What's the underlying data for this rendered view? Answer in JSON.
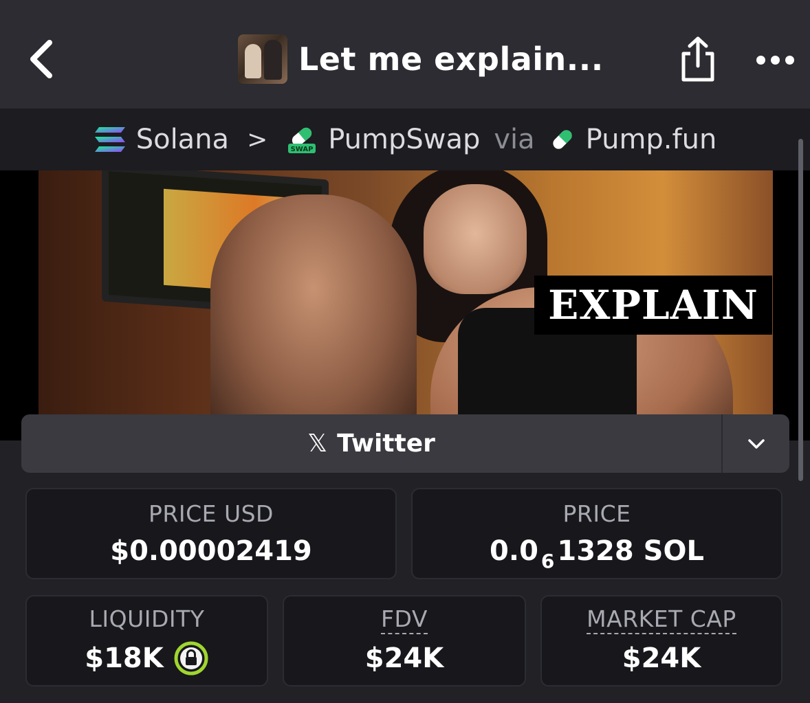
{
  "header": {
    "title": "Let me explain..."
  },
  "breadcrumb": {
    "chain": "Solana",
    "separator": ">",
    "dex": "PumpSwap",
    "dex_badge": "SWAP",
    "via_text": "via",
    "launchpad": "Pump.fun"
  },
  "banner": {
    "overlay_text": "EXPLAIN"
  },
  "links": {
    "twitter_label": "Twitter"
  },
  "stats": {
    "price_usd": {
      "label": "PRICE USD",
      "value": "$0.00002419"
    },
    "price": {
      "label": "PRICE",
      "value_prefix": "0.0",
      "value_subscript": "6",
      "value_suffix": "1328 SOL"
    },
    "liquidity": {
      "label": "LIQUIDITY",
      "value": "$18K"
    },
    "fdv": {
      "label": "FDV",
      "value": "$24K"
    },
    "market_cap": {
      "label": "MARKET CAP",
      "value": "$24K"
    }
  },
  "colors": {
    "lock_ring": "#9fd62f",
    "topbar_bg": "#2c2c32",
    "card_bg": "#17171c"
  },
  "icons": [
    "back-chevron-icon",
    "share-icon",
    "more-icon",
    "solana-icon",
    "pumpswap-icon",
    "pill-icon",
    "x-icon",
    "chevron-down-icon",
    "lock-icon"
  ]
}
